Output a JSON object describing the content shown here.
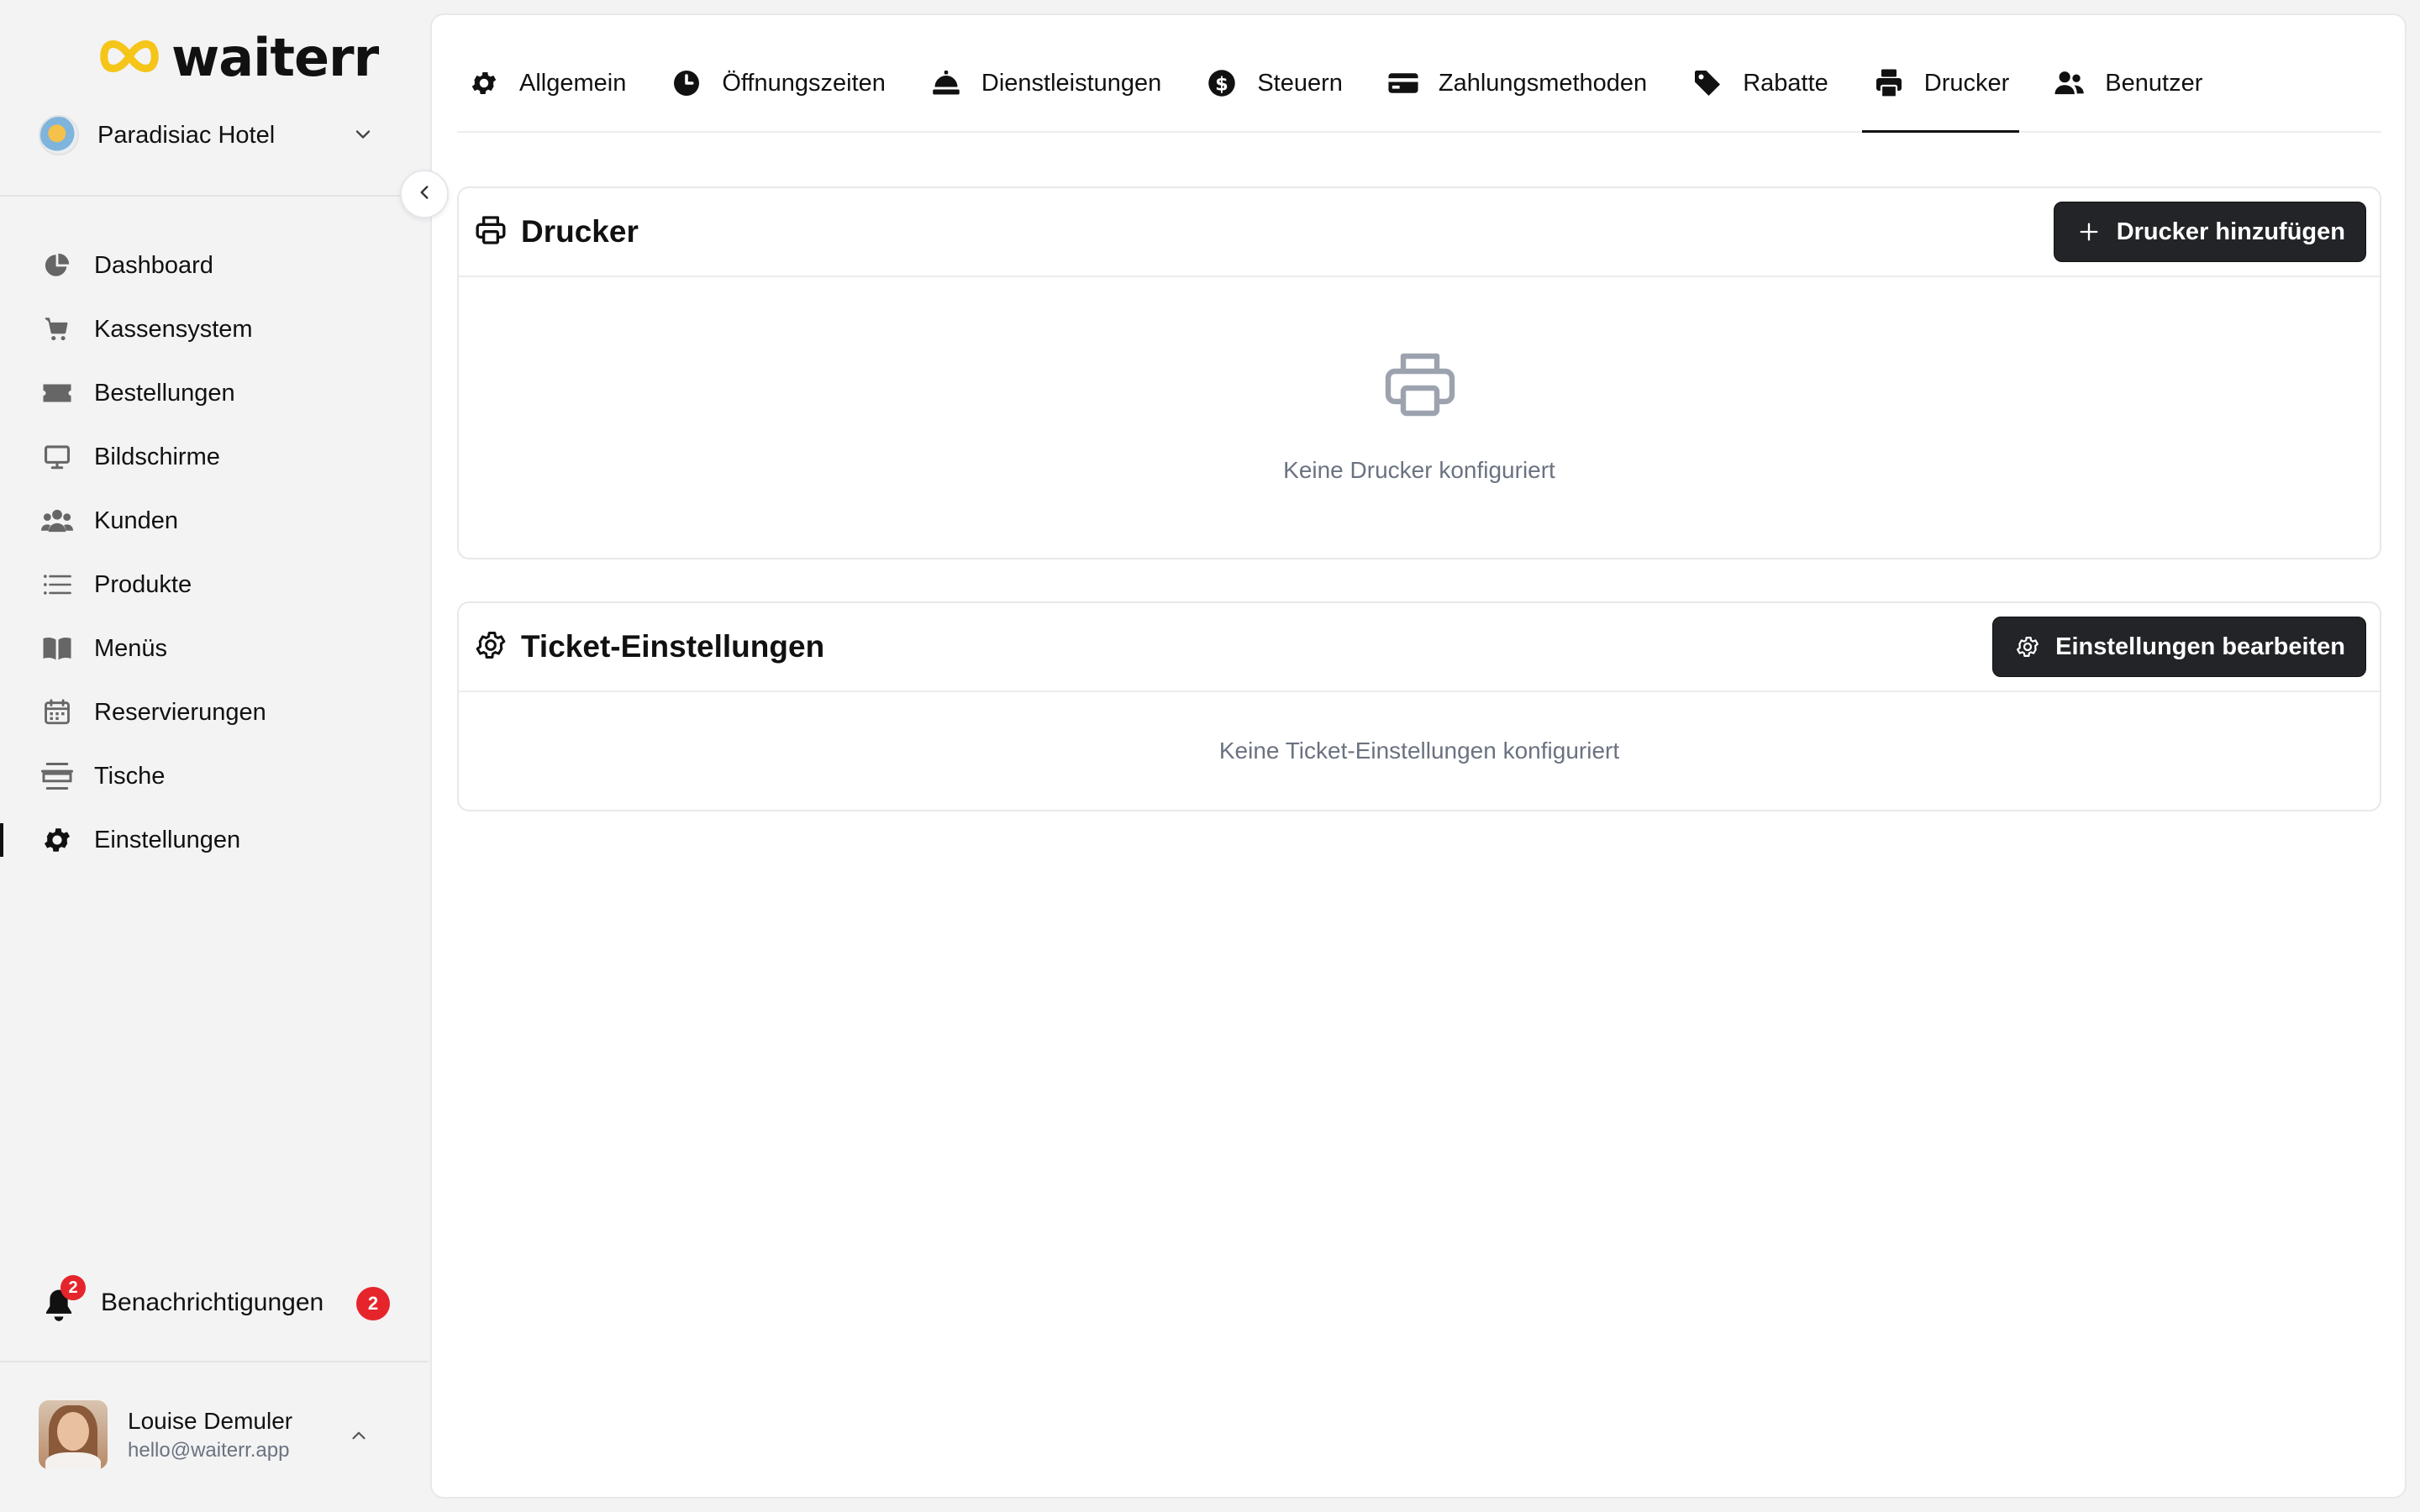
{
  "brand": {
    "name": "waiterr",
    "accent": "#f5c518"
  },
  "hotel": {
    "name": "Paradisiac Hotel"
  },
  "nav": {
    "items": [
      {
        "label": "Dashboard",
        "icon": "pie-chart-icon"
      },
      {
        "label": "Kassensystem",
        "icon": "cart-icon"
      },
      {
        "label": "Bestellungen",
        "icon": "ticket-icon"
      },
      {
        "label": "Bildschirme",
        "icon": "monitor-icon"
      },
      {
        "label": "Kunden",
        "icon": "users-icon"
      },
      {
        "label": "Produkte",
        "icon": "list-icon"
      },
      {
        "label": "Menüs",
        "icon": "book-icon"
      },
      {
        "label": "Reservierungen",
        "icon": "calendar-icon"
      },
      {
        "label": "Tische",
        "icon": "table-icon"
      },
      {
        "label": "Einstellungen",
        "icon": "gear-icon",
        "active": true
      }
    ]
  },
  "notifications": {
    "label": "Benachrichtigungen",
    "count": "2",
    "badge": "2"
  },
  "user": {
    "name": "Louise Demuler",
    "email": "hello@waiterr.app"
  },
  "tabs": [
    {
      "label": "Allgemein",
      "icon": "gear-icon"
    },
    {
      "label": "Öffnungszeiten",
      "icon": "clock-icon"
    },
    {
      "label": "Dienstleistungen",
      "icon": "cloche-icon"
    },
    {
      "label": "Steuern",
      "icon": "dollar-circle-icon"
    },
    {
      "label": "Zahlungsmethoden",
      "icon": "credit-card-icon"
    },
    {
      "label": "Rabatte",
      "icon": "tag-icon"
    },
    {
      "label": "Drucker",
      "icon": "printer-icon",
      "active": true
    },
    {
      "label": "Benutzer",
      "icon": "users-icon"
    }
  ],
  "printers": {
    "title": "Drucker",
    "add_button": "Drucker hinzufügen",
    "empty_text": "Keine Drucker konfiguriert"
  },
  "ticket_settings": {
    "title": "Ticket-Einstellungen",
    "edit_button": "Einstellungen bearbeiten",
    "empty_text": "Keine Ticket-Einstellungen konfiguriert"
  }
}
